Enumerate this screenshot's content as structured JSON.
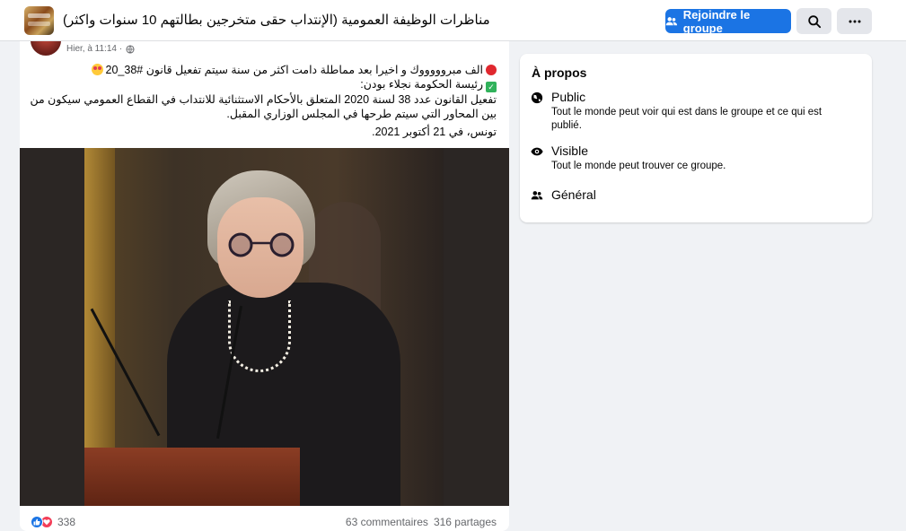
{
  "header": {
    "group_title": "مناظرات الوظيفة العمومية (الإنتداب حقى متخرجين بطالتهم 10 سنوات واكثر)",
    "join_label": "Rejoindre le groupe",
    "icons": {
      "join": "people-icon",
      "search": "search-icon",
      "more": "more-icon"
    }
  },
  "post": {
    "timestamp": "Hier, à 11:14 ·",
    "lines": [
      "الف مبروووووك و اخيرا بعد مماطلة دامت اكثر من سنة سيتم تفعيل قانون #38_20",
      "رئيسة الحكومة نجلاء بودن:",
      "تفعيل  القانون عدد 38 لسنة 2020 المتعلق بالأحكام الاستثنائية للانتداب في القطاع العمومي سيكون من بين المحاور التي سيتم طرحها في المجلس الوزاري المقبل.",
      "تونس، في 21 أكتوبر 2021."
    ],
    "reactions_count": "338",
    "comments": "63 commentaires",
    "shares": "316 partages"
  },
  "about": {
    "title": "À propos",
    "items": [
      {
        "icon": "globe-icon",
        "title": "Public",
        "desc": "Tout le monde peut voir qui est dans le groupe et ce qui est publié."
      },
      {
        "icon": "eye-icon",
        "title": "Visible",
        "desc": "Tout le monde peut trouver ce groupe."
      },
      {
        "icon": "people-icon",
        "title": "Général",
        "desc": ""
      }
    ]
  },
  "colors": {
    "accent": "#1b74e4",
    "background": "#f0f2f5",
    "like": "#1b74e4",
    "love": "#f33e58"
  }
}
